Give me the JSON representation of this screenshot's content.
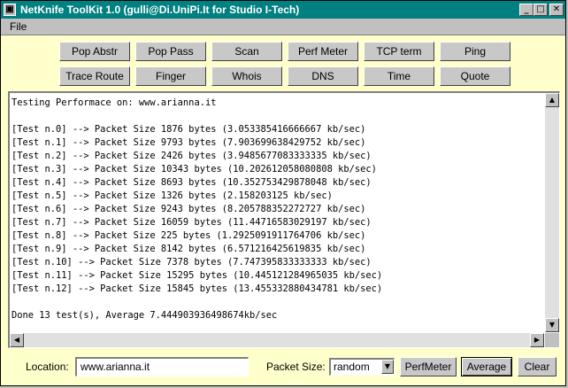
{
  "window": {
    "title": "NetKnife ToolKit 1.0 (gulli@Di.UniPi.It for Studio I-Tech)",
    "minimize_icon": "minimize-icon",
    "maximize_icon": "maximize-icon",
    "close_icon": "close-icon"
  },
  "menu": {
    "file": "File"
  },
  "tools_row1": [
    "Pop Abstr",
    "Pop Pass",
    "Scan",
    "Perf Meter",
    "TCP term",
    "Ping"
  ],
  "tools_row2": [
    "Trace Route",
    "Finger",
    "Whois",
    "DNS",
    "Time",
    "Quote"
  ],
  "output": {
    "lines": [
      "Testing Performace on: www.arianna.it",
      "",
      "[Test n.0] --> Packet Size 1876 bytes (3.053385416666667 kb/sec)",
      "[Test n.1] --> Packet Size 9793 bytes (7.903699638429752 kb/sec)",
      "[Test n.2] --> Packet Size 2426 bytes (3.9485677083333335 kb/sec)",
      "[Test n.3] --> Packet Size 10343 bytes (10.202612058080808 kb/sec)",
      "[Test n.4] --> Packet Size 8693 bytes (10.352753429878048 kb/sec)",
      "[Test n.5] --> Packet Size 1326 bytes (2.158203125 kb/sec)",
      "[Test n.6] --> Packet Size 9243 bytes (8.205788352272727 kb/sec)",
      "[Test n.7] --> Packet Size 16059 bytes (11.44716583029197 kb/sec)",
      "[Test n.8] --> Packet Size 225 bytes (1.2925091911764706 kb/sec)",
      "[Test n.9] --> Packet Size 8142 bytes (6.571216425619835 kb/sec)",
      "[Test n.10] --> Packet Size 7378 bytes (7.747395833333333 kb/sec)",
      "[Test n.11] --> Packet Size 15295 bytes (10.445121284965035 kb/sec)",
      "[Test n.12] --> Packet Size 15845 bytes (13.455332880434781 kb/sec)",
      "",
      "Done 13 test(s), Average 7.444903936498674kb/sec"
    ]
  },
  "bottom": {
    "location_label": "Location:",
    "location_value": "www.arianna.it",
    "packet_size_label": "Packet Size:",
    "packet_size_value": "random",
    "perfmeter_button": "PerfMeter",
    "average_button": "Average",
    "clear_button": "Clear"
  }
}
